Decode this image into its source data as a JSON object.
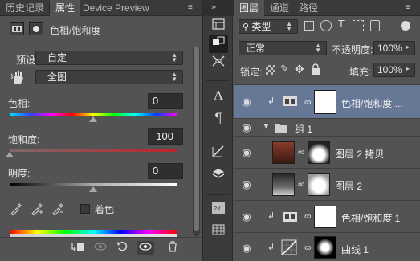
{
  "left_panel": {
    "tabs": [
      {
        "label": "历史记录",
        "active": false
      },
      {
        "label": "属性",
        "active": true
      },
      {
        "label": "Device Preview",
        "active": false
      }
    ],
    "menu_icon": "panel-menu-icon",
    "title": "色相/饱和度",
    "preset_label": "预设:",
    "preset_value": "自定",
    "range_value": "全图",
    "hue_label": "色相:",
    "hue_value": "0",
    "saturation_label": "饱和度:",
    "saturation_value": "-100",
    "lightness_label": "明度:",
    "lightness_value": "0",
    "colorize_label": "着色",
    "hue_level": 0.5,
    "saturation_level": 0.0,
    "lightness_level": 0.5
  },
  "right_panel": {
    "tabs": [
      {
        "label": "图层",
        "active": true
      },
      {
        "label": "通道",
        "active": false
      },
      {
        "label": "路径",
        "active": false
      }
    ],
    "kind_filter": "类型",
    "blend_mode": "正常",
    "opacity_label": "不透明度:",
    "opacity_value": "100%",
    "lock_label": "锁定:",
    "fill_label": "填充:",
    "fill_value": "100%",
    "layers": [
      {
        "name": "色相/饱和度 ...",
        "type": "adjustment",
        "clipped": true,
        "selected": true
      },
      {
        "name": "组 1",
        "type": "group",
        "clipped": false,
        "selected": false
      },
      {
        "name": "图层 2 拷贝",
        "type": "image",
        "clipped": false,
        "selected": false
      },
      {
        "name": "图层 2",
        "type": "image",
        "clipped": false,
        "selected": false
      },
      {
        "name": "色相/饱和度 1",
        "type": "adjustment",
        "clipped": true,
        "selected": false
      },
      {
        "name": "曲线 1",
        "type": "curves",
        "clipped": true,
        "selected": false
      }
    ]
  },
  "colors": {
    "panel_bg": "#535353",
    "tab_bg": "#3a3a3a",
    "selected_row": "#677796",
    "saturation_track": "#c0222a"
  }
}
